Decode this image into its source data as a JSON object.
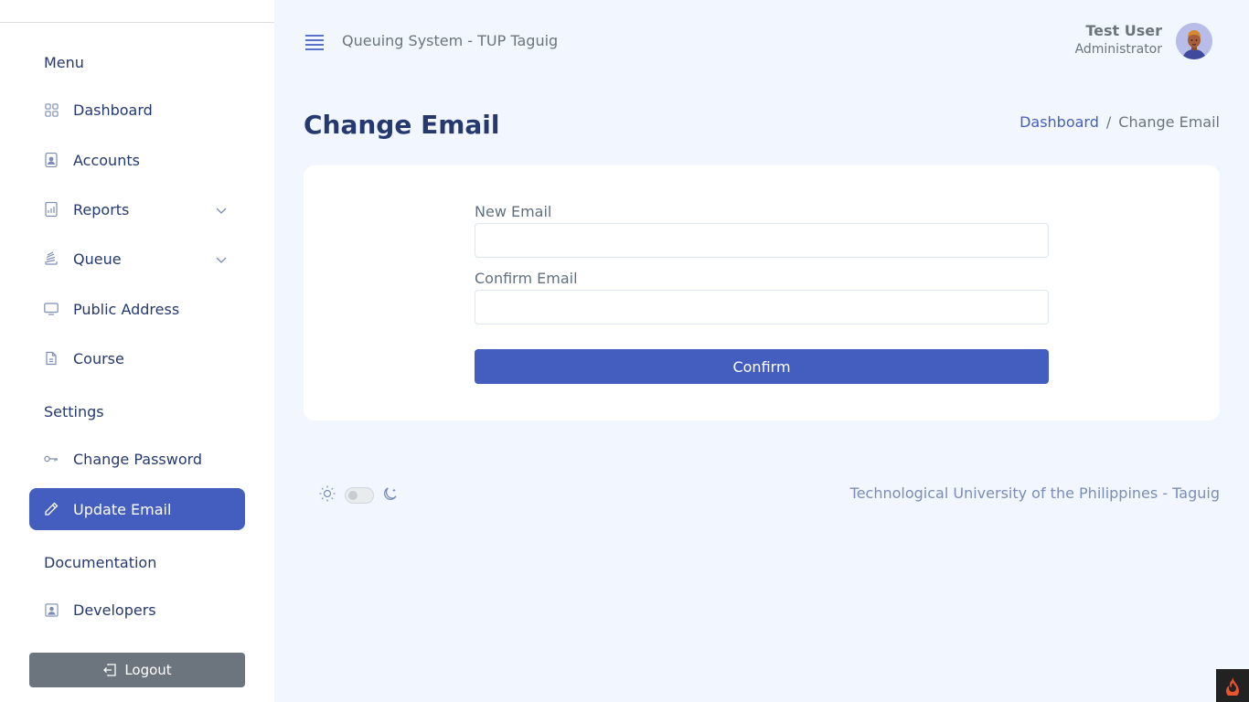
{
  "sidebar": {
    "sections": {
      "menu": "Menu",
      "settings": "Settings",
      "documentation": "Documentation"
    },
    "items": {
      "dashboard": "Dashboard",
      "accounts": "Accounts",
      "reports": "Reports",
      "queue": "Queue",
      "public_address": "Public Address",
      "course": "Course",
      "change_password": "Change Password",
      "update_email": "Update Email",
      "developers": "Developers"
    },
    "logout": "Logout"
  },
  "header": {
    "app_title": "Queuing System - TUP Taguig",
    "user_name": "Test User",
    "user_role": "Administrator"
  },
  "page": {
    "title": "Change Email",
    "breadcrumb": {
      "link": "Dashboard",
      "separator": "/",
      "current": "Change Email"
    }
  },
  "form": {
    "new_email_label": "New Email",
    "new_email_value": "",
    "confirm_email_label": "Confirm Email",
    "confirm_email_value": "",
    "confirm_button": "Confirm"
  },
  "footer": {
    "text": "Technological University of the Philippines - Taguig",
    "theme": "light"
  },
  "colors": {
    "primary": "#435ebe",
    "heading": "#25396f",
    "background": "#f2f7ff",
    "logout": "#6c757d"
  },
  "icons": {
    "dashboard": "grid-icon",
    "accounts": "person-badge-icon",
    "reports": "bar-chart-icon",
    "queue": "stack-icon",
    "public_address": "display-icon",
    "course": "file-icon",
    "change_password": "key-icon",
    "update_email": "pencil-icon",
    "developers": "person-square-icon",
    "logout": "box-arrow-left-icon"
  }
}
